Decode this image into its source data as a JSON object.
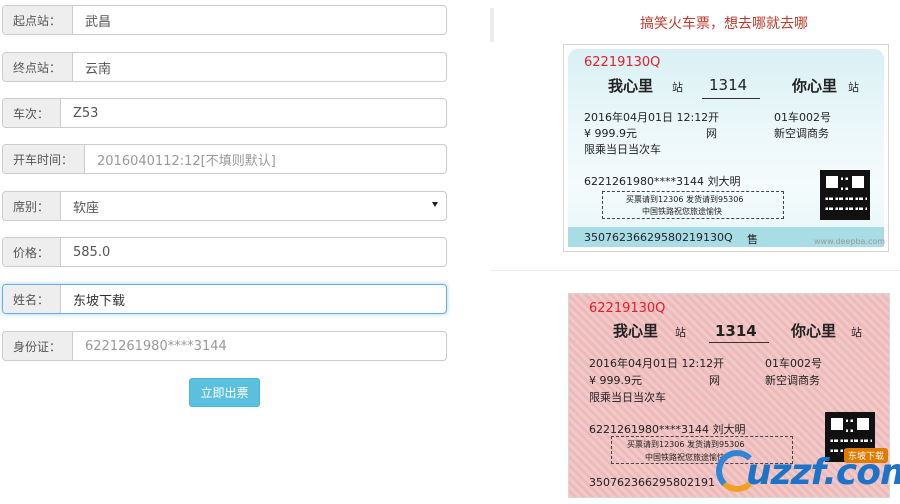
{
  "form": {
    "start_station": {
      "label": "起点站：",
      "value": "武昌"
    },
    "end_station": {
      "label": "终点站：",
      "value": "云南"
    },
    "train_no": {
      "label": "车次：",
      "value": "Z53"
    },
    "depart_time": {
      "label": "开车时间：",
      "value": "2016040112:12[不填则默认]"
    },
    "seat_type": {
      "label": "席别：",
      "value": "软座"
    },
    "price": {
      "label": "价格：",
      "value": "585.0"
    },
    "name": {
      "label": "姓名：",
      "value": "东坡下载"
    },
    "id_card": {
      "label": "身份证：",
      "value": "6221261980****3144"
    },
    "submit_label": "立即出票"
  },
  "preview": {
    "heading": "搞笑火车票，想去哪就去哪",
    "ticket": {
      "code": "62219130Q",
      "from": "我心里",
      "to": "你心里",
      "station_suffix": "站",
      "train": "1314",
      "date_line": "2016年04月01日 12:12开",
      "seat_no": "01车002号",
      "price_line": "¥ 999.9元",
      "booking_channel": "网",
      "class": "新空调商务",
      "restriction": "限乘当日当次车",
      "passenger": "6221261980****3144 刘大明",
      "notice_1": "买票请到12306 发货请到95306",
      "notice_2": "中国铁路祝您旅途愉快",
      "serial": "35076236629580219130Q",
      "serial_red": "350762366295802191",
      "sale_mark": "售",
      "watermark": "www.deepba.com"
    }
  },
  "logo": {
    "text": "uzzf.com",
    "badge": "东坡下载"
  }
}
